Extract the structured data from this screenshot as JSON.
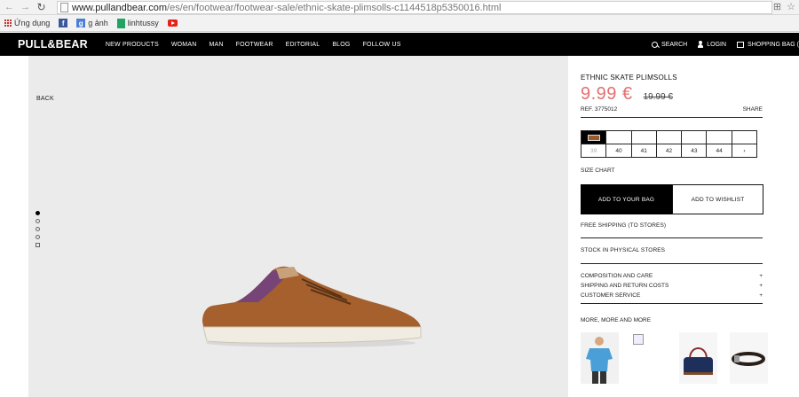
{
  "browser": {
    "url_host": "www.pullandbear.com",
    "url_path": "/es/en/footwear/footwear-sale/ethnic-skate-plimsolls-c1144518p5350016.html",
    "bookmarks": [
      {
        "label": "Ứng dụng",
        "icon": "apps-grid-icon"
      },
      {
        "label": "",
        "icon": "facebook-icon"
      },
      {
        "label": "g ảnh",
        "icon": "google-icon"
      },
      {
        "label": "linhtussy",
        "icon": "sheets-icon"
      },
      {
        "label": "",
        "icon": "youtube-icon"
      }
    ]
  },
  "nav": {
    "logo": "PULL&BEAR",
    "menu": [
      "NEW PRODUCTS",
      "WOMAN",
      "MAN",
      "FOOTWEAR",
      "EDITORIAL",
      "BLOG",
      "FOLLOW US"
    ],
    "search": "SEARCH",
    "login": "LOGIN",
    "bag": "SHOPPING BAG ("
  },
  "gallery": {
    "back": "BACK",
    "image_count": 5,
    "active_index": 0
  },
  "product": {
    "name": "ETHNIC SKATE PLIMSOLLS",
    "price": "9.99 €",
    "old_price": "19.99 €",
    "ref": "REF. 3775012",
    "share": "SHARE",
    "color_swatch": "#9a5a2b",
    "sizes": [
      "39",
      "40",
      "41",
      "42",
      "43",
      "44"
    ],
    "size_next": "›",
    "size_chart": "SIZE CHART",
    "add_to_bag": "ADD TO YOUR BAG",
    "add_to_wishlist": "ADD TO WISHLIST",
    "free_shipping": "FREE SHIPPING (TO STORES)",
    "stock": "STOCK IN PHYSICAL STORES",
    "accordion": [
      {
        "label": "COMPOSITION AND CARE",
        "sign": "+"
      },
      {
        "label": "SHIPPING AND RETURN COSTS",
        "sign": "+"
      },
      {
        "label": "CUSTOMER SERVICE",
        "sign": "+"
      }
    ],
    "more_title": "MORE, MORE AND MORE"
  }
}
